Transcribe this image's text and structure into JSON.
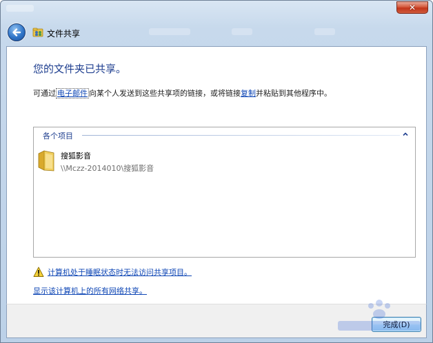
{
  "window": {
    "close_label": "✕"
  },
  "nav": {
    "title": "文件共享"
  },
  "content": {
    "heading": "您的文件夹已共享。",
    "instruction_prefix": "可通过",
    "instruction_link_email": "电子邮件",
    "instruction_middle": "向某个人发送到这些共享项的链接，或将链接",
    "instruction_link_copy": "复制",
    "instruction_suffix": "并粘贴到其他程序中。"
  },
  "items_panel": {
    "group_label": "各个项目",
    "items": [
      {
        "name": "搜狐影音",
        "path": "\\\\Mczz-2014010\\搜狐影音"
      }
    ]
  },
  "links": {
    "sleep_warning": "计算机处于睡眠状态时无法访问共享项目。",
    "show_all_shares": "显示该计算机上的所有网络共享。"
  },
  "footer": {
    "finish_label": "完成(D)"
  },
  "colors": {
    "heading": "#1e3e8f",
    "link": "#0e46b5",
    "frame": "#bcd1e8",
    "folder": "#e8c24a"
  }
}
